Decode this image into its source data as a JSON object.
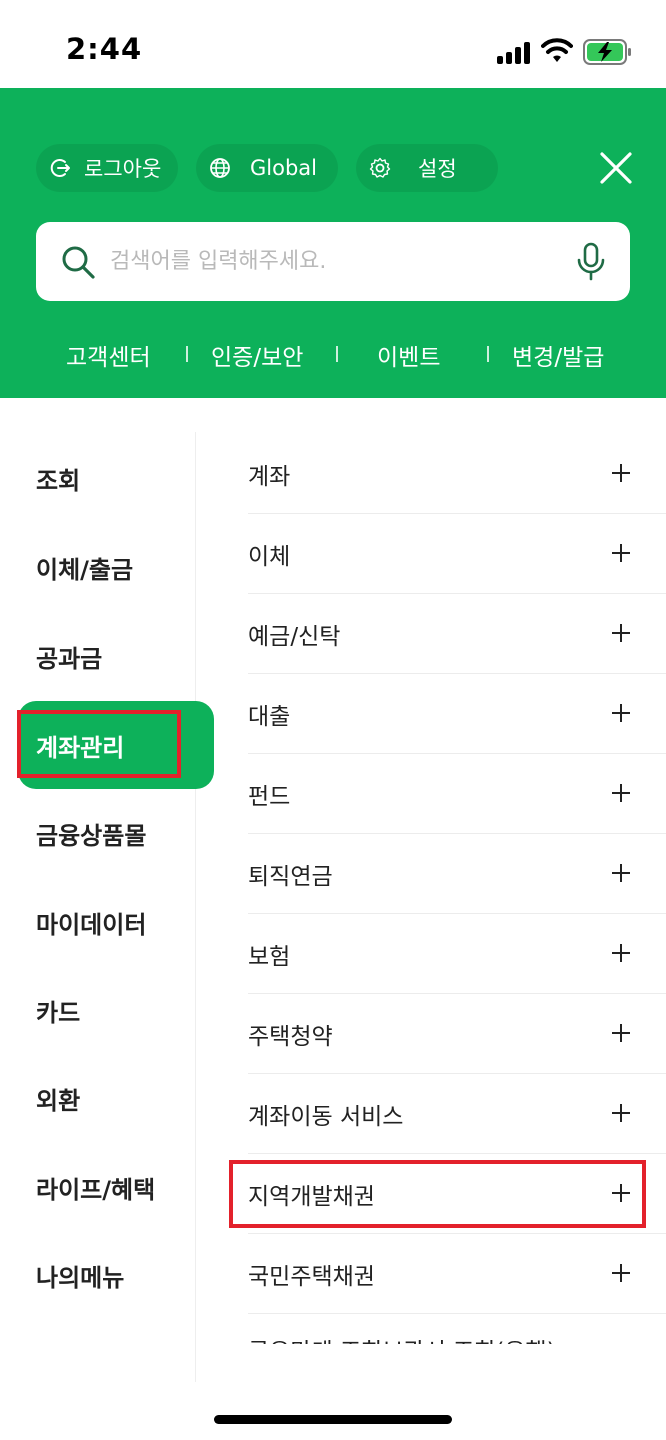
{
  "status_bar": {
    "time": "2:44"
  },
  "header": {
    "chips": {
      "logout": "로그아웃",
      "global": "Global",
      "settings": "설정"
    },
    "search": {
      "placeholder": "검색어를 입력해주세요."
    },
    "quick_links": [
      "고객센터",
      "인증/보안",
      "이벤트",
      "변경/발급"
    ]
  },
  "categories": [
    "조회",
    "이체/출금",
    "공과금",
    "계좌관리",
    "금융상품몰",
    "마이데이터",
    "카드",
    "외환",
    "라이프/혜택",
    "나의메뉴"
  ],
  "active_category": "계좌관리",
  "submenu": [
    "계좌",
    "이체",
    "예금/신탁",
    "대출",
    "펀드",
    "퇴직연금",
    "보험",
    "주택청약",
    "계좌이동 서비스",
    "지역개발채권",
    "국민주택채권"
  ],
  "submenu_partial": "공유마케 조회보관서 조회(은행)",
  "highlighted_items": [
    "계좌관리",
    "지역개발채권"
  ],
  "colors": {
    "brand_green": "#0db15a",
    "highlight_red": "#e3212b"
  }
}
